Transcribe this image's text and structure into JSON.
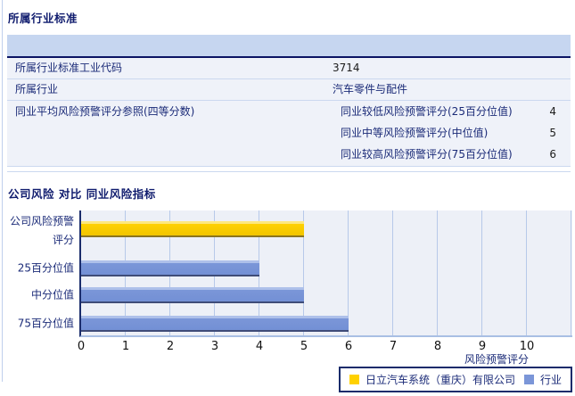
{
  "section1": {
    "title": "所属行业标准",
    "rows": [
      {
        "label": "所属行业标准工业代码",
        "value": "3714",
        "value_style": "plain"
      },
      {
        "label": "所属行业",
        "value": "汽车零件与配件",
        "value_style": "navy"
      }
    ],
    "peer_row": {
      "label": "同业平均风险预警评分参照(四等分数)",
      "items": [
        {
          "label": "同业较低风险预警评分(25百分位值)",
          "value": "4"
        },
        {
          "label": "同业中等风险预警评分(中位值)",
          "value": "5"
        },
        {
          "label": "同业较高风险预警评分(75百分位值)",
          "value": "6"
        }
      ]
    }
  },
  "section2": {
    "title": "公司风险 对比 同业风险指标"
  },
  "chart_data": {
    "type": "bar",
    "orientation": "horizontal",
    "categories": [
      "公司风险预警评分",
      "25百分位值",
      "中分位值",
      "75百分位值"
    ],
    "series": [
      {
        "name": "日立汽车系统（重庆）有限公司",
        "color": "#FFD100",
        "values": [
          5,
          null,
          null,
          null
        ]
      },
      {
        "name": "行业",
        "color": "#7B96D8",
        "values": [
          null,
          4,
          5,
          6
        ]
      }
    ],
    "xlabel": "风险预警评分",
    "xlim": [
      0,
      10
    ],
    "xticks": [
      0,
      1,
      2,
      3,
      4,
      5,
      6,
      7,
      8,
      9,
      10
    ],
    "grid": true,
    "legend_position": "bottom-right",
    "plot_background": "#EDF0F7",
    "gridline_color": "#B7C9E9"
  },
  "colors": {
    "header_band": "#C6D6F0",
    "band_border": "#0B1464",
    "row_background": "#EFF2F9",
    "row_separator": "#CBD8EF",
    "title_text": "#101C6E",
    "label_text": "#1B2B78",
    "company_bar": "#FFD100",
    "industry_bar": "#7B96D8"
  }
}
